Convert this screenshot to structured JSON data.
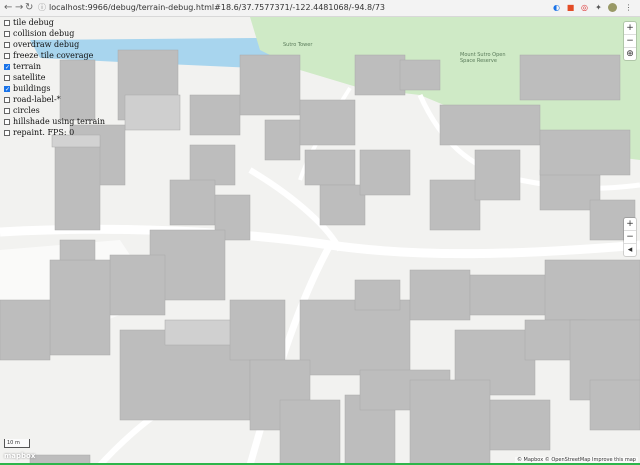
{
  "browser": {
    "url": "localhost:9966/debug/terrain-debug.html#18.6/37.7577371/-122.4481068/-94.8/73",
    "back_icon": "arrow-left-icon",
    "forward_icon": "arrow-right-icon",
    "reload_icon": "reload-icon"
  },
  "debug": {
    "options": [
      {
        "label": "tile debug",
        "checked": false
      },
      {
        "label": "collision debug",
        "checked": false
      },
      {
        "label": "overdraw debug",
        "checked": false
      },
      {
        "label": "freeze tile coverage",
        "checked": false
      },
      {
        "label": "terrain",
        "checked": true
      },
      {
        "label": "satellite",
        "checked": false
      },
      {
        "label": "buildings",
        "checked": true
      },
      {
        "label": "road-label-*",
        "checked": false
      },
      {
        "label": "circles",
        "checked": false
      },
      {
        "label": "hillshade using terrain",
        "checked": false
      },
      {
        "label": "repaint. FPS: 0",
        "checked": false
      }
    ]
  },
  "map": {
    "poi_1": "Sutro Tower",
    "poi_2": "Mount Sutro Open Space Reserve",
    "scale": "10 m",
    "logo": "mapbox",
    "attribution": "© Mapbox © OpenStreetMap Improve this map",
    "colors": {
      "land": "#f1f1ef",
      "park": "#cfeac6",
      "water": "#a8d5ee",
      "building": "#b9b9b9",
      "road": "#ffffff"
    }
  },
  "controls": {
    "zoom_in": "+",
    "zoom_out": "−",
    "compass": "◂",
    "zoom_in2": "+",
    "zoom_out2": "−",
    "pitch": "⊕"
  }
}
